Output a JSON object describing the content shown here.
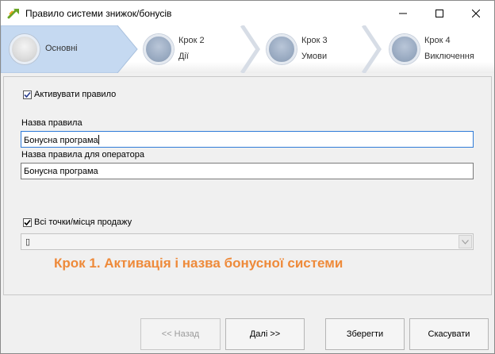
{
  "window": {
    "title": "Правило системи знижок/бонусів"
  },
  "steps": [
    {
      "label": "Основні",
      "active": true
    },
    {
      "number": "Крок 2",
      "label": "Дії",
      "active": false
    },
    {
      "number": "Крок 3",
      "label": "Умови",
      "active": false
    },
    {
      "number": "Крок 4",
      "label": "Виключення",
      "active": false
    }
  ],
  "form": {
    "activate_label": "Активувати правило",
    "activate_checked": true,
    "rule_name_label": "Назва правила",
    "rule_name_value": "Бонусна програма",
    "operator_name_label": "Назва правила для оператора",
    "operator_name_value": "Бонусна програма",
    "all_points_label": "Всі точки/місця продажу",
    "all_points_checked": true,
    "points_combo_value": "▯"
  },
  "hint": "Крок 1. Активація і назва бонусної системи",
  "buttons": {
    "back": "<< Назад",
    "next": "Далі >>",
    "save": "Зберегти",
    "cancel": "Скасувати"
  },
  "colors": {
    "active_step": "#c5d9f1",
    "hint": "#ee8a3a",
    "focus_border": "#2f7bd8"
  }
}
